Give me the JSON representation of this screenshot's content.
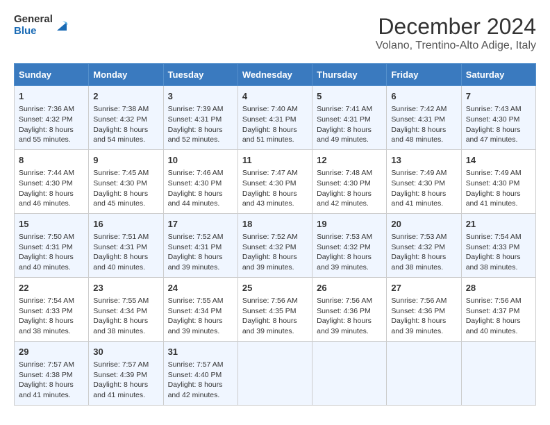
{
  "logo": {
    "line1": "General",
    "line2": "Blue"
  },
  "title": "December 2024",
  "subtitle": "Volano, Trentino-Alto Adige, Italy",
  "days_of_week": [
    "Sunday",
    "Monday",
    "Tuesday",
    "Wednesday",
    "Thursday",
    "Friday",
    "Saturday"
  ],
  "weeks": [
    [
      {
        "day": "1",
        "sunrise": "Sunrise: 7:36 AM",
        "sunset": "Sunset: 4:32 PM",
        "daylight": "Daylight: 8 hours and 55 minutes."
      },
      {
        "day": "2",
        "sunrise": "Sunrise: 7:38 AM",
        "sunset": "Sunset: 4:32 PM",
        "daylight": "Daylight: 8 hours and 54 minutes."
      },
      {
        "day": "3",
        "sunrise": "Sunrise: 7:39 AM",
        "sunset": "Sunset: 4:31 PM",
        "daylight": "Daylight: 8 hours and 52 minutes."
      },
      {
        "day": "4",
        "sunrise": "Sunrise: 7:40 AM",
        "sunset": "Sunset: 4:31 PM",
        "daylight": "Daylight: 8 hours and 51 minutes."
      },
      {
        "day": "5",
        "sunrise": "Sunrise: 7:41 AM",
        "sunset": "Sunset: 4:31 PM",
        "daylight": "Daylight: 8 hours and 49 minutes."
      },
      {
        "day": "6",
        "sunrise": "Sunrise: 7:42 AM",
        "sunset": "Sunset: 4:31 PM",
        "daylight": "Daylight: 8 hours and 48 minutes."
      },
      {
        "day": "7",
        "sunrise": "Sunrise: 7:43 AM",
        "sunset": "Sunset: 4:30 PM",
        "daylight": "Daylight: 8 hours and 47 minutes."
      }
    ],
    [
      {
        "day": "8",
        "sunrise": "Sunrise: 7:44 AM",
        "sunset": "Sunset: 4:30 PM",
        "daylight": "Daylight: 8 hours and 46 minutes."
      },
      {
        "day": "9",
        "sunrise": "Sunrise: 7:45 AM",
        "sunset": "Sunset: 4:30 PM",
        "daylight": "Daylight: 8 hours and 45 minutes."
      },
      {
        "day": "10",
        "sunrise": "Sunrise: 7:46 AM",
        "sunset": "Sunset: 4:30 PM",
        "daylight": "Daylight: 8 hours and 44 minutes."
      },
      {
        "day": "11",
        "sunrise": "Sunrise: 7:47 AM",
        "sunset": "Sunset: 4:30 PM",
        "daylight": "Daylight: 8 hours and 43 minutes."
      },
      {
        "day": "12",
        "sunrise": "Sunrise: 7:48 AM",
        "sunset": "Sunset: 4:30 PM",
        "daylight": "Daylight: 8 hours and 42 minutes."
      },
      {
        "day": "13",
        "sunrise": "Sunrise: 7:49 AM",
        "sunset": "Sunset: 4:30 PM",
        "daylight": "Daylight: 8 hours and 41 minutes."
      },
      {
        "day": "14",
        "sunrise": "Sunrise: 7:49 AM",
        "sunset": "Sunset: 4:30 PM",
        "daylight": "Daylight: 8 hours and 41 minutes."
      }
    ],
    [
      {
        "day": "15",
        "sunrise": "Sunrise: 7:50 AM",
        "sunset": "Sunset: 4:31 PM",
        "daylight": "Daylight: 8 hours and 40 minutes."
      },
      {
        "day": "16",
        "sunrise": "Sunrise: 7:51 AM",
        "sunset": "Sunset: 4:31 PM",
        "daylight": "Daylight: 8 hours and 40 minutes."
      },
      {
        "day": "17",
        "sunrise": "Sunrise: 7:52 AM",
        "sunset": "Sunset: 4:31 PM",
        "daylight": "Daylight: 8 hours and 39 minutes."
      },
      {
        "day": "18",
        "sunrise": "Sunrise: 7:52 AM",
        "sunset": "Sunset: 4:32 PM",
        "daylight": "Daylight: 8 hours and 39 minutes."
      },
      {
        "day": "19",
        "sunrise": "Sunrise: 7:53 AM",
        "sunset": "Sunset: 4:32 PM",
        "daylight": "Daylight: 8 hours and 39 minutes."
      },
      {
        "day": "20",
        "sunrise": "Sunrise: 7:53 AM",
        "sunset": "Sunset: 4:32 PM",
        "daylight": "Daylight: 8 hours and 38 minutes."
      },
      {
        "day": "21",
        "sunrise": "Sunrise: 7:54 AM",
        "sunset": "Sunset: 4:33 PM",
        "daylight": "Daylight: 8 hours and 38 minutes."
      }
    ],
    [
      {
        "day": "22",
        "sunrise": "Sunrise: 7:54 AM",
        "sunset": "Sunset: 4:33 PM",
        "daylight": "Daylight: 8 hours and 38 minutes."
      },
      {
        "day": "23",
        "sunrise": "Sunrise: 7:55 AM",
        "sunset": "Sunset: 4:34 PM",
        "daylight": "Daylight: 8 hours and 38 minutes."
      },
      {
        "day": "24",
        "sunrise": "Sunrise: 7:55 AM",
        "sunset": "Sunset: 4:34 PM",
        "daylight": "Daylight: 8 hours and 39 minutes."
      },
      {
        "day": "25",
        "sunrise": "Sunrise: 7:56 AM",
        "sunset": "Sunset: 4:35 PM",
        "daylight": "Daylight: 8 hours and 39 minutes."
      },
      {
        "day": "26",
        "sunrise": "Sunrise: 7:56 AM",
        "sunset": "Sunset: 4:36 PM",
        "daylight": "Daylight: 8 hours and 39 minutes."
      },
      {
        "day": "27",
        "sunrise": "Sunrise: 7:56 AM",
        "sunset": "Sunset: 4:36 PM",
        "daylight": "Daylight: 8 hours and 39 minutes."
      },
      {
        "day": "28",
        "sunrise": "Sunrise: 7:56 AM",
        "sunset": "Sunset: 4:37 PM",
        "daylight": "Daylight: 8 hours and 40 minutes."
      }
    ],
    [
      {
        "day": "29",
        "sunrise": "Sunrise: 7:57 AM",
        "sunset": "Sunset: 4:38 PM",
        "daylight": "Daylight: 8 hours and 41 minutes."
      },
      {
        "day": "30",
        "sunrise": "Sunrise: 7:57 AM",
        "sunset": "Sunset: 4:39 PM",
        "daylight": "Daylight: 8 hours and 41 minutes."
      },
      {
        "day": "31",
        "sunrise": "Sunrise: 7:57 AM",
        "sunset": "Sunset: 4:40 PM",
        "daylight": "Daylight: 8 hours and 42 minutes."
      },
      null,
      null,
      null,
      null
    ]
  ]
}
